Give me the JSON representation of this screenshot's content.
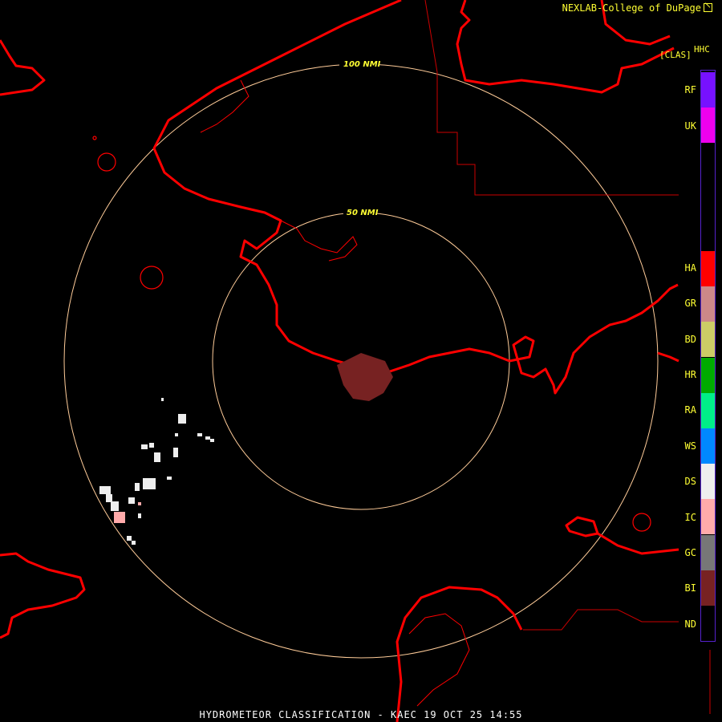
{
  "credit": "NEXLAB-College of DuPage",
  "product_code": "HHC",
  "product_class": "[CLAS]",
  "footer": "HYDROMETEOR CLASSIFICATION - KAEC 19 OCT 25 14:55",
  "rings": [
    {
      "label": "100 NMI"
    },
    {
      "label": "50 NMI"
    }
  ],
  "legend": [
    {
      "code": "RF",
      "color": "#7711ff"
    },
    {
      "code": "UK",
      "color": "#ee00ee"
    },
    {
      "code": "HA",
      "color": "#ff0000"
    },
    {
      "code": "GR",
      "color": "#cc8888"
    },
    {
      "code": "BD",
      "color": "#cccc66"
    },
    {
      "code": "HR",
      "color": "#00aa00"
    },
    {
      "code": "RA",
      "color": "#00ee88"
    },
    {
      "code": "WS",
      "color": "#0088ff"
    },
    {
      "code": "DS",
      "color": "#eeeeee"
    },
    {
      "code": "IC",
      "color": "#ffaaaa"
    },
    {
      "code": "GC",
      "color": "#777777"
    },
    {
      "code": "BI",
      "color": "#772222"
    },
    {
      "code": "ND",
      "color": "#000000"
    }
  ],
  "colors": {
    "coast": "#ff0000",
    "border": "#cc0000",
    "ring": "#ffcc99",
    "biological": "#772222"
  }
}
